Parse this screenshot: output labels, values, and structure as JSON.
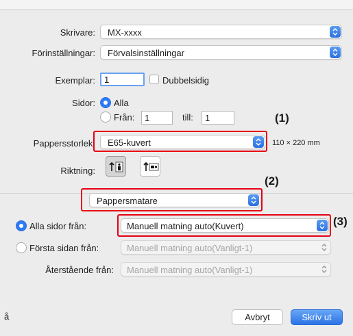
{
  "printer": {
    "label": "Skrivare:",
    "value": "MX-xxxx"
  },
  "presets": {
    "label": "Förinställningar:",
    "value": "Förvalsinställningar"
  },
  "copies": {
    "label": "Exemplar:",
    "value": "1",
    "duplex_label": "Dubbelsidig"
  },
  "pages": {
    "label": "Sidor:",
    "all_label": "Alla",
    "from_label": "Från:",
    "from_value": "1",
    "to_label": "till:",
    "to_value": "1"
  },
  "paper_size": {
    "label": "Pappersstorlek:",
    "value": "E65-kuvert",
    "dimensions": "110 × 220 mm"
  },
  "orientation": {
    "label": "Riktning:",
    "options": [
      "portrait",
      "landscape"
    ],
    "selected": "portrait"
  },
  "panel_select": {
    "value": "Pappersmatare"
  },
  "feed": {
    "all_pages_label": "Alla sidor från:",
    "all_pages_value": "Manuell matning auto(Kuvert)",
    "first_page_label": "Första sidan från:",
    "first_page_value": "Manuell matning auto(Vanligt-1)",
    "remaining_label": "Återstående från:",
    "remaining_value": "Manuell matning auto(Vanligt-1)",
    "selected": "all_pages"
  },
  "footer": {
    "left_text": "å",
    "cancel_label": "Avbryt",
    "print_label": "Skriv ut"
  },
  "callouts": {
    "c1": "(1)",
    "c2": "(2)",
    "c3": "(3)"
  },
  "colors": {
    "accent": "#2f7af5",
    "highlight": "#e60012",
    "pane": "#ececec"
  },
  "icons": [
    "chevron-updown-icon",
    "portrait-orientation-icon",
    "landscape-orientation-icon"
  ]
}
